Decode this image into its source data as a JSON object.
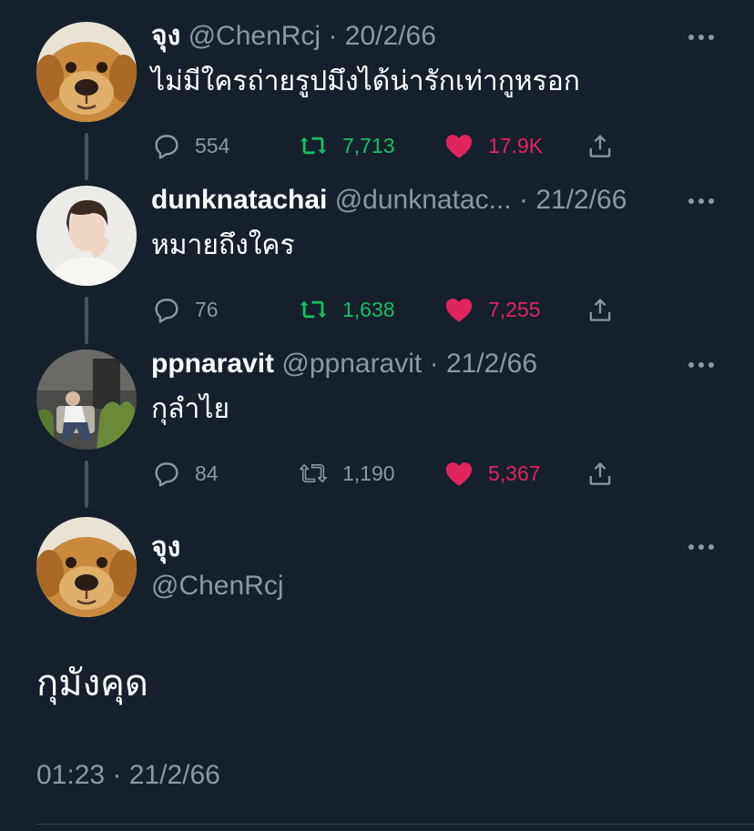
{
  "colors": {
    "background": "#15202b",
    "secondary_text": "#8b98a5",
    "retweet_active": "#17bf63",
    "like_active": "#e0245e",
    "thread_line": "#3d5466"
  },
  "tweets": [
    {
      "name": "จุง",
      "handle": "@ChenRcj",
      "sep": "·",
      "date": "20/2/66",
      "text": "ไม่มีใครถ่ายรูปมึงได้น่ารักเท่ากูหรอก",
      "avatar": "golden-retriever-puppy",
      "replies": "554",
      "retweets": "7,713",
      "likes": "17.9K",
      "retweeted": true,
      "liked": true
    },
    {
      "name": "dunknatachai",
      "handle": "@dunknatac...",
      "sep": "·",
      "date": "21/2/66",
      "text": "หมายถึงใคร",
      "avatar": "person-white-shirt",
      "replies": "76",
      "retweets": "1,638",
      "likes": "7,255",
      "retweeted": true,
      "liked": true
    },
    {
      "name": "ppnaravit",
      "handle": "@ppnaravit",
      "sep": "·",
      "date": "21/2/66",
      "text": "กุลำไย",
      "avatar": "person-sitting-plants",
      "replies": "84",
      "retweets": "1,190",
      "likes": "5,367",
      "retweeted": false,
      "liked": true
    }
  ],
  "main_tweet": {
    "name": "จุง",
    "handle": "@ChenRcj",
    "text": "กุมังคุด",
    "timestamp": "01:23 · 21/2/66",
    "avatar": "golden-retriever-puppy"
  },
  "icons": {
    "reply": "reply-icon",
    "retweet": "retweet-icon",
    "like": "heart-icon",
    "share": "share-icon",
    "more": "more-icon"
  }
}
